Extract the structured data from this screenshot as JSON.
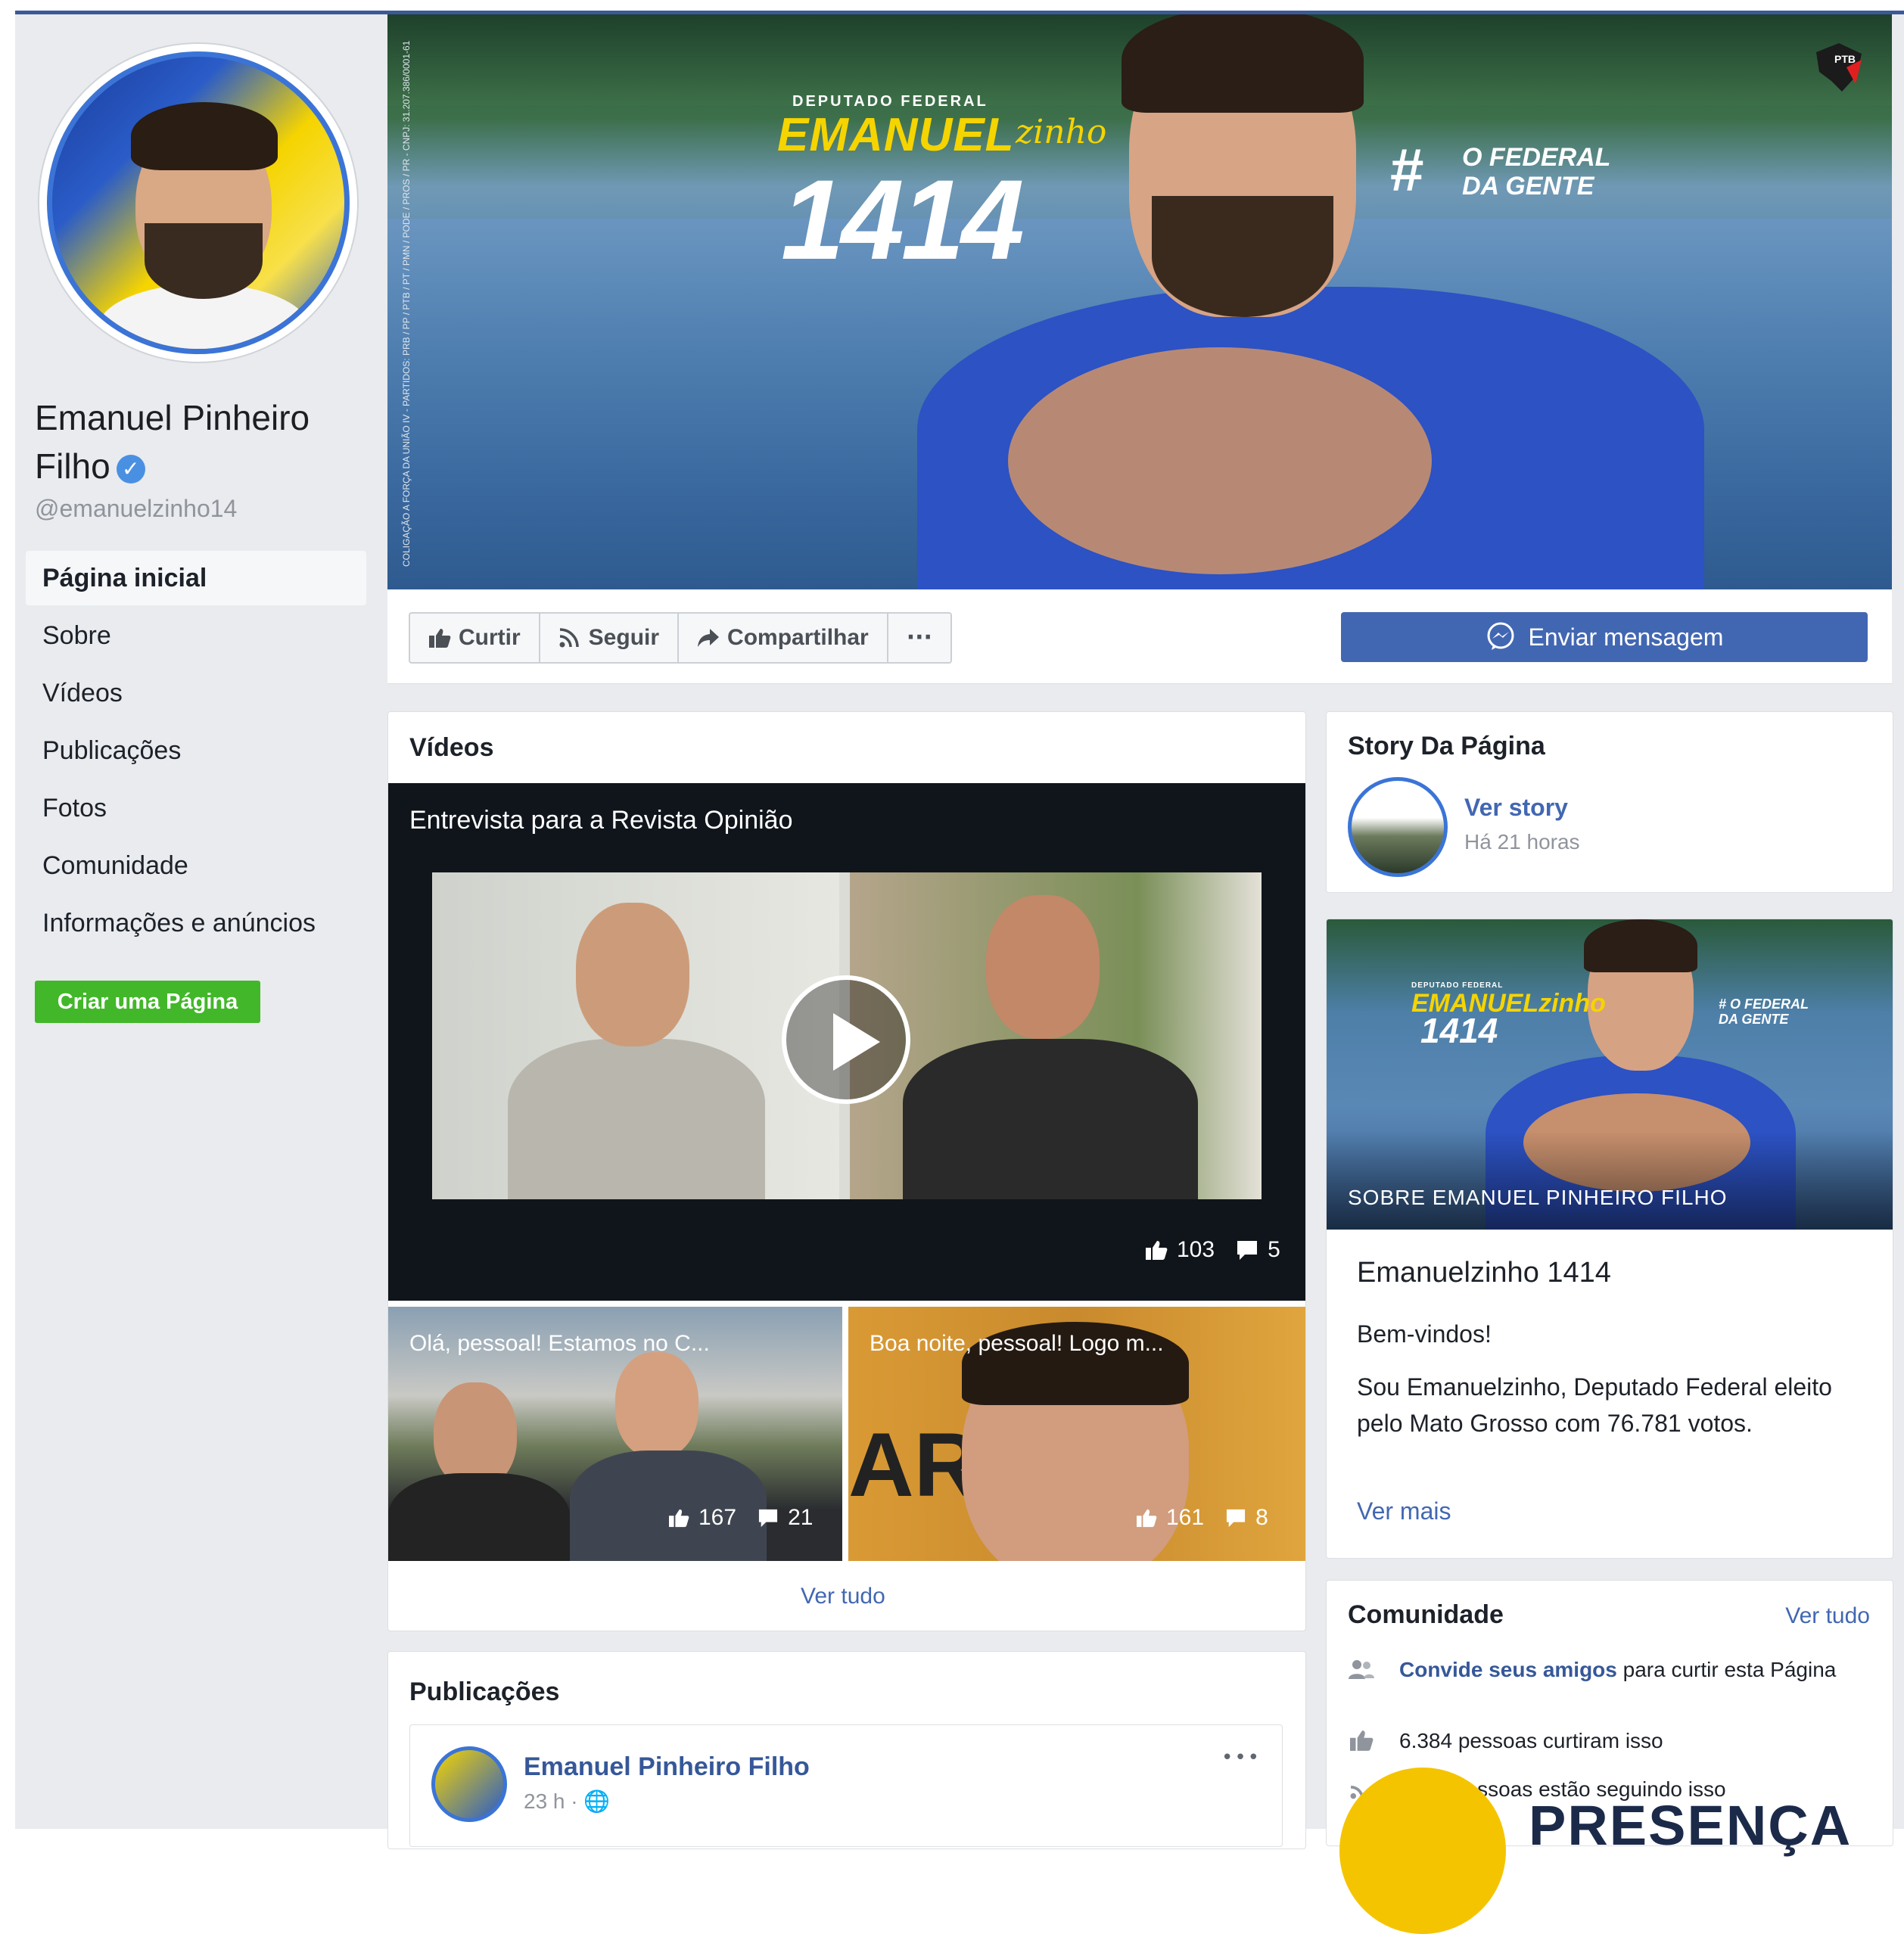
{
  "colors": {
    "accent": "#4267b2",
    "create_button": "#42b72a",
    "verified": "#4a90e2",
    "background": "#e9ebee"
  },
  "profile": {
    "name_line1": "Emanuel Pinheiro",
    "name_line2": "Filho",
    "verified_icon": "✓",
    "handle": "@emanuelzinho14"
  },
  "nav": {
    "items": [
      {
        "label": "Página inicial",
        "active": true
      },
      {
        "label": "Sobre"
      },
      {
        "label": "Vídeos"
      },
      {
        "label": "Publicações"
      },
      {
        "label": "Fotos"
      },
      {
        "label": "Comunidade"
      },
      {
        "label": "Informações e anúncios"
      }
    ],
    "create_page": "Criar uma Página"
  },
  "cover": {
    "kicker": "DEPUTADO FEDERAL",
    "name": "EMANUEL",
    "name_script": "zinho",
    "number": "1414",
    "hashtag": "#",
    "tag_line1": "O FEDERAL",
    "tag_line2": "DA GENTE",
    "party_badge": "PTB",
    "side_text": "COLIGAÇÃO A FORÇA DA UNIÃO IV - PARTIDOS: PRB / PP / PTB / PT / PMN / PODE / PROS / PR - CNPJ: 31.207.386/0001-61"
  },
  "actions": {
    "like": "Curtir",
    "follow": "Seguir",
    "share": "Compartilhar",
    "more": "···",
    "message": "Enviar mensagem"
  },
  "videos": {
    "title": "Vídeos",
    "main": {
      "title": "Entrevista para a Revista Opinião",
      "likes": "103",
      "comments": "5"
    },
    "thumbs": [
      {
        "title": "Olá, pessoal! Estamos no C...",
        "likes": "167",
        "comments": "21"
      },
      {
        "title": "Boa noite, pessoal! Logo m...",
        "likes": "161",
        "comments": "8"
      }
    ],
    "see_all": "Ver tudo"
  },
  "story": {
    "title": "Story Da Página",
    "link": "Ver story",
    "time": "Há 21 horas"
  },
  "about": {
    "image_caption": "SOBRE EMANUEL PINHEIRO FILHO",
    "img_kicker": "DEPUTADO FEDERAL",
    "img_name": "EMANUELzinho",
    "img_number": "1414",
    "img_tag_line1": "# O FEDERAL",
    "img_tag_line2": "DA GENTE",
    "heading": "Emanuelzinho 1414",
    "greeting": "Bem-vindos!",
    "description": "Sou Emanuelzinho, Deputado Federal eleito pelo Mato Grosso com 76.781 votos.",
    "see_more": "Ver mais"
  },
  "community": {
    "title": "Comunidade",
    "see_all": "Ver tudo",
    "invite_link": "Convide seus amigos",
    "invite_rest": " para curtir esta Página",
    "likes_text": "6.384 pessoas curtiram isso",
    "following_text": "pessoas estão seguindo isso"
  },
  "posts": {
    "title": "Publicações",
    "author": "Emanuel Pinheiro Filho",
    "time": "23 h · ",
    "globe_icon": "🌐",
    "more": "•••"
  },
  "watermark": {
    "text": "PRESENÇA"
  }
}
